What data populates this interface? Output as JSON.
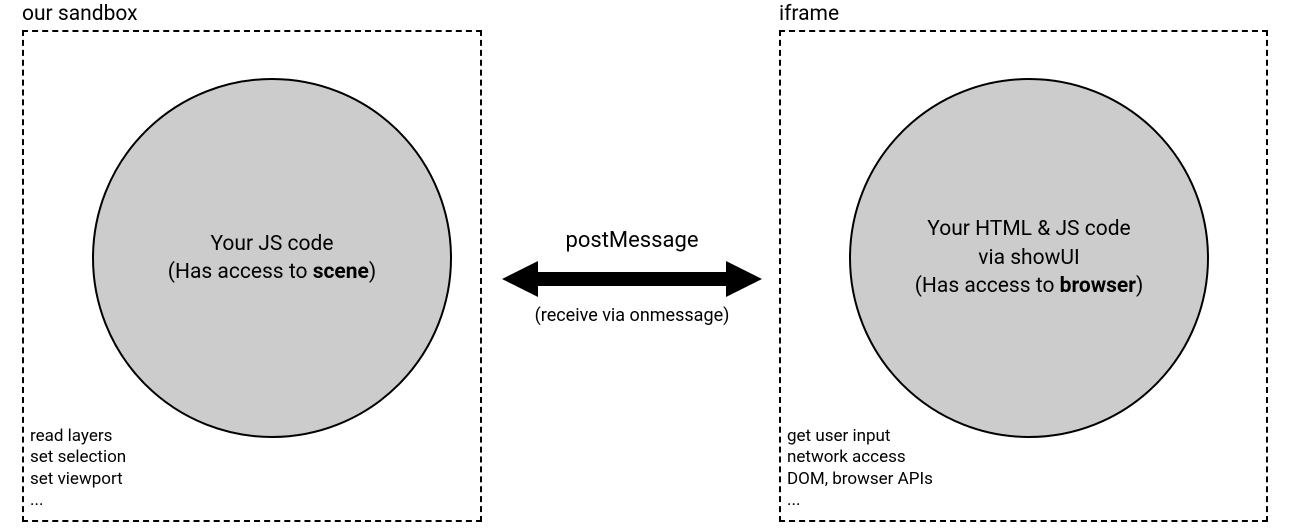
{
  "left": {
    "title": "our sandbox",
    "circle": {
      "line1": "Your JS code",
      "line2_prefix": "(Has access to ",
      "line2_bold": "scene",
      "line2_suffix": ")"
    },
    "caps": [
      "read layers",
      "set selection",
      "set viewport",
      "..."
    ]
  },
  "right": {
    "title": "iframe",
    "circle": {
      "line1": "Your  HTML & JS code",
      "line2": "via showUI",
      "line3_prefix": "(Has access to ",
      "line3_bold": "browser",
      "line3_suffix": ")"
    },
    "caps": [
      "get user input",
      "network access",
      "DOM, browser APIs",
      "..."
    ]
  },
  "arrow": {
    "top": "postMessage",
    "bottom": "(receive via onmessage)"
  }
}
